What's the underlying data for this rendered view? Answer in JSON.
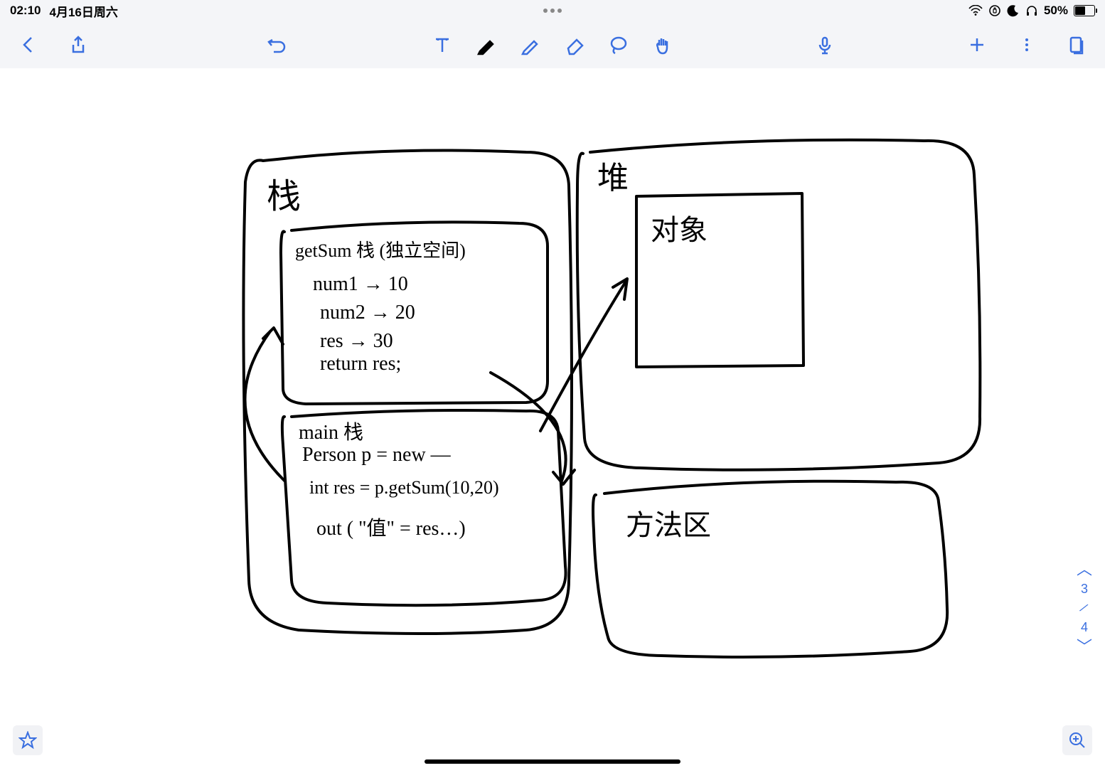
{
  "status": {
    "time": "02:10",
    "date": "4月16日周六",
    "battery_pct": "50%"
  },
  "toolbar": {},
  "page_nav": {
    "current": "3",
    "total": "4"
  },
  "handwriting": {
    "stack_title": "栈",
    "getsum_header": "getSum 栈 (独立空间)",
    "num1": "num1 → 10",
    "num2": "num2 → 20",
    "res": "res → 30",
    "return": "return res;",
    "main_header": "main 栈",
    "person_new": "Person p = new —",
    "int_res": "int res = p.getSum(10,20)",
    "out": "out ( \"值\" = res…)",
    "heap_title": "堆",
    "object": "对象",
    "method_area": "方法区"
  }
}
